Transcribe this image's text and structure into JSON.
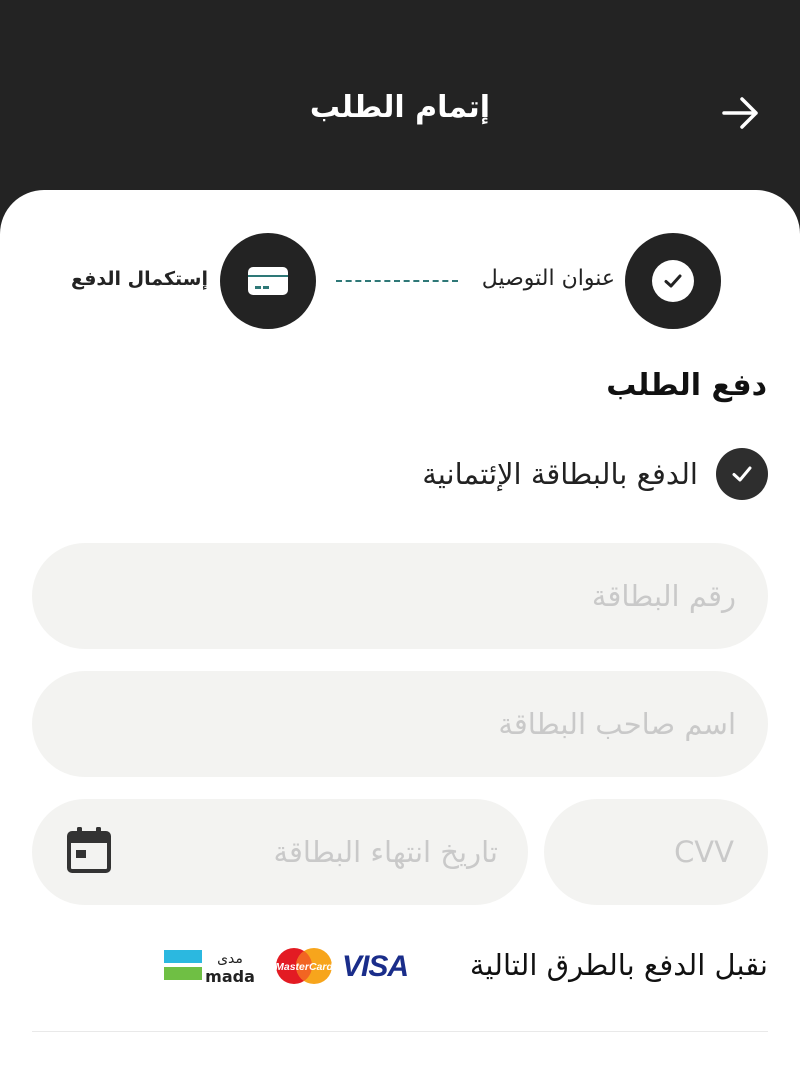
{
  "header": {
    "title": "إتمام الطلب"
  },
  "steps": [
    {
      "label": "عنوان التوصيل",
      "state": "completed",
      "icon": "check-icon"
    },
    {
      "label": "إستكمال الدفع",
      "state": "current",
      "icon": "credit-card-icon"
    }
  ],
  "payment": {
    "section_title": "دفع الطلب",
    "method_label": "الدفع بالبطاقة الإئتمانية",
    "fields": {
      "card_number": {
        "placeholder": "رقم البطاقة",
        "value": ""
      },
      "card_holder": {
        "placeholder": "اسم صاحب البطاقة",
        "value": ""
      },
      "expiry": {
        "placeholder": "تاريخ انتهاء البطاقة",
        "value": ""
      },
      "cvv": {
        "placeholder": "CVV",
        "value": ""
      }
    },
    "accepted_text": "نقبل الدفع بالطرق التالية",
    "brands": {
      "visa": "VISA",
      "mastercard": "MasterCard",
      "mada_ar": "مدى",
      "mada_en": "mada"
    }
  },
  "colors": {
    "dark": "#232323",
    "accent": "#2e7877",
    "field_bg": "#f3f3f1",
    "placeholder": "#c9c9c9"
  }
}
